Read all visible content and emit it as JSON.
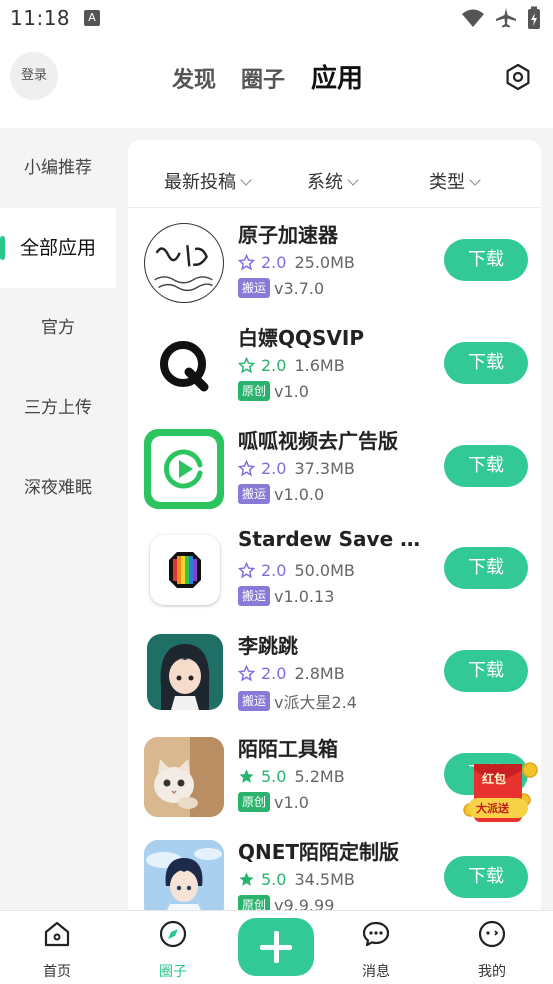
{
  "status_bar": {
    "time": "11:18",
    "notification_letter": "A"
  },
  "header": {
    "login_label": "登录",
    "tabs": [
      {
        "label": "发现",
        "active": false
      },
      {
        "label": "圈子",
        "active": false
      },
      {
        "label": "应用",
        "active": true
      }
    ],
    "settings_icon": "hexagon-settings-icon"
  },
  "sidebar": {
    "items": [
      {
        "label": "小编推荐",
        "active": false
      },
      {
        "label": "全部应用",
        "active": true
      },
      {
        "label": "官方",
        "active": false
      },
      {
        "label": "三方上传",
        "active": false
      },
      {
        "label": "深夜难眠",
        "active": false
      }
    ]
  },
  "filters": [
    {
      "label": "最新投稿"
    },
    {
      "label": "系统"
    },
    {
      "label": "类型"
    }
  ],
  "apps": [
    {
      "name": "原子加速器",
      "score": "2.0",
      "rated": false,
      "size": "25.0MB",
      "tag": "搬运",
      "version": "v3.7.0",
      "download_label": "下载",
      "icon": "calligraphy-icon"
    },
    {
      "name": "白嫖QQSVIP",
      "score": "2.0",
      "rated": false,
      "size": "1.6MB",
      "tag": "原创",
      "version": "v1.0",
      "download_label": "下载",
      "icon": "q-logo-icon"
    },
    {
      "name": "呱呱视频去广告版",
      "score": "2.0",
      "rated": false,
      "size": "37.3MB",
      "tag": "搬运",
      "version": "v1.0.0",
      "download_label": "下载",
      "icon": "video-play-icon"
    },
    {
      "name": "Stardew Save Editor",
      "score": "2.0",
      "rated": false,
      "size": "50.0MB",
      "tag": "搬运",
      "version": "v1.0.13",
      "download_label": "下载",
      "icon": "rainbow-gem-icon"
    },
    {
      "name": "李跳跳",
      "score": "2.0",
      "rated": false,
      "size": "2.8MB",
      "tag": "搬运",
      "version": "v派大星2.4",
      "download_label": "下载",
      "icon": "anime-girl-icon"
    },
    {
      "name": "陌陌工具箱",
      "score": "5.0",
      "rated": true,
      "size": "5.2MB",
      "tag": "原创",
      "version": "v1.0",
      "download_label": "下载",
      "icon": "kitten-icon"
    },
    {
      "name": "QNET陌陌定制版",
      "score": "5.0",
      "rated": true,
      "size": "34.5MB",
      "tag": "原创",
      "version": "v9.9.99",
      "download_label": "下载",
      "icon": "anime-boy-icon"
    }
  ],
  "red_packet": {
    "line1": "红包",
    "line2": "大派送"
  },
  "bottom_nav": [
    {
      "label": "首页",
      "icon": "home-icon",
      "active": false
    },
    {
      "label": "圈子",
      "icon": "compass-icon",
      "active": true
    },
    {
      "label": "消息",
      "icon": "chat-bubble-icon",
      "active": false
    },
    {
      "label": "我的",
      "icon": "profile-face-icon",
      "active": false
    }
  ],
  "fab_icon": "plus-icon",
  "colors": {
    "accent": "#33c996",
    "tag_move": "#8a7ad8",
    "tag_orig": "#2bb36e",
    "star_purple": "#7d6ee0",
    "star_green": "#27b46e"
  }
}
